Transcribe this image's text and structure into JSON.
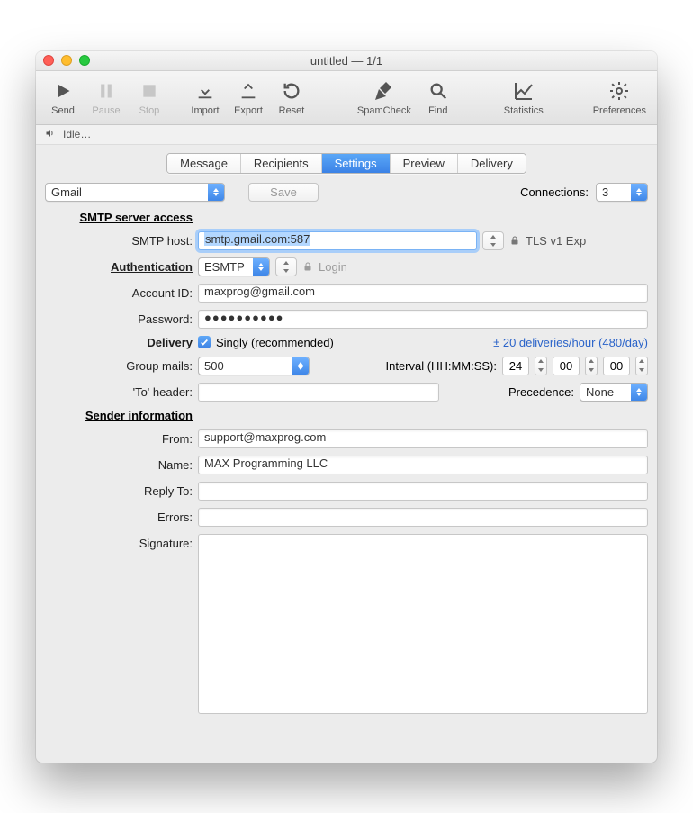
{
  "window_title": "untitled — 1/1",
  "toolbar": {
    "send": "Send",
    "pause": "Pause",
    "stop": "Stop",
    "import": "Import",
    "export": "Export",
    "reset": "Reset",
    "spamcheck": "SpamCheck",
    "find": "Find",
    "statistics": "Statistics",
    "preferences": "Preferences"
  },
  "status": "Idle…",
  "tabs": [
    "Message",
    "Recipients",
    "Settings",
    "Preview",
    "Delivery"
  ],
  "active_tab": "Settings",
  "account_select": "Gmail",
  "save_btn": "Save",
  "connections_label": "Connections:",
  "connections_value": "3",
  "sections": {
    "smtp": "SMTP server access",
    "auth": "Authentication",
    "delivery": "Delivery",
    "sender": "Sender information"
  },
  "labels": {
    "smtp_host": "SMTP host:",
    "account_id": "Account ID:",
    "password": "Password:",
    "group_mails": "Group mails:",
    "to_header": "'To' header:",
    "from": "From:",
    "name": "Name:",
    "reply_to": "Reply To:",
    "errors": "Errors:",
    "signature": "Signature:",
    "interval": "Interval (HH:MM:SS):",
    "precedence": "Precedence:"
  },
  "values": {
    "smtp_host": "smtp.gmail.com:587",
    "tls": "TLS v1 Exp",
    "auth_method": "ESMTP",
    "login_btn": "Login",
    "account_id": "maxprog@gmail.com",
    "password": "●●●●●●●●●●",
    "singly": "Singly (recommended)",
    "rate": "± 20 deliveries/hour (480/day)",
    "group_mails": "500",
    "interval_hh": "24",
    "interval_mm": "00",
    "interval_ss": "00",
    "precedence": "None",
    "from": "support@maxprog.com",
    "name": "MAX Programming LLC",
    "reply_to": "",
    "errors": "",
    "signature": ""
  }
}
